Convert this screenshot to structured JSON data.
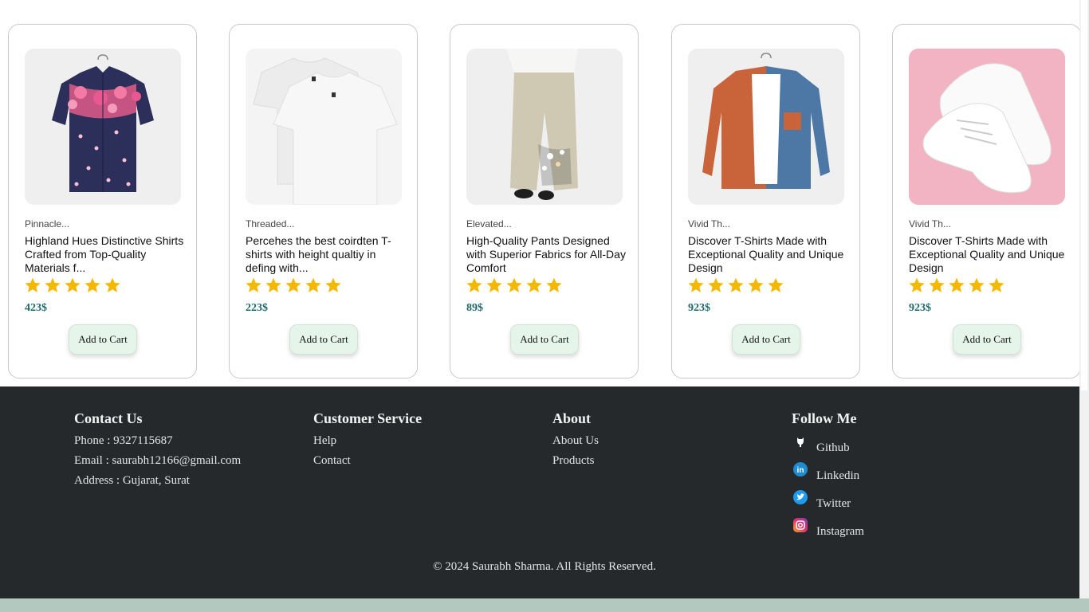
{
  "products": [
    {
      "brand": "Pinnacle...",
      "title": "Highland Hues Distinctive Shirts Crafted from Top-Quality Materials f...",
      "rating": 5,
      "price": "423$",
      "button": "Add to Cart",
      "image": "floral-shirt-image"
    },
    {
      "brand": "Threaded...",
      "title": "Percehes the best coirdten T-shirts with height qualtiy in defing with...",
      "rating": 5,
      "price": "223$",
      "button": "Add to Cart",
      "image": "white-tshirts-image"
    },
    {
      "brand": "Elevated...",
      "title": "High-Quality Pants Designed with Superior Fabrics for All-Day Comfort",
      "rating": 5,
      "price": "89$",
      "button": "Add to Cart",
      "image": "linen-pants-image"
    },
    {
      "brand": "Vivid Th...",
      "title": "Discover T-Shirts Made with Exceptional Quality and Unique Design",
      "rating": 5,
      "price": "923$",
      "button": "Add to Cart",
      "image": "two-tone-shirt-image"
    },
    {
      "brand": "Vivid Th...",
      "title": "Discover T-Shirts Made with Exceptional Quality and Unique Design",
      "rating": 5,
      "price": "923$",
      "button": "Add to Cart",
      "image": "white-sneakers-image"
    }
  ],
  "footer": {
    "contact": {
      "heading": "Contact Us",
      "phone": "Phone : 9327115687",
      "email": "Email : saurabh12166@gmail.com",
      "address": "Address : Gujarat, Surat"
    },
    "service": {
      "heading": "Customer Service",
      "links": [
        "Help",
        "Contact"
      ]
    },
    "about": {
      "heading": "About",
      "links": [
        "About Us",
        "Products"
      ]
    },
    "follow": {
      "heading": "Follow Me",
      "links": [
        {
          "label": "Github",
          "icon": "github-icon"
        },
        {
          "label": "Linkedin",
          "icon": "linkedin-icon"
        },
        {
          "label": "Twitter",
          "icon": "twitter-icon"
        },
        {
          "label": "Instagram",
          "icon": "instagram-icon"
        }
      ]
    },
    "copyright": "© 2024 Saurabh Sharma. All Rights Reserved."
  },
  "colors": {
    "price": "#1f6a6a",
    "star": "#f5b800",
    "button_bg": "#e6f5ea",
    "footer_bg": "#25292c"
  }
}
